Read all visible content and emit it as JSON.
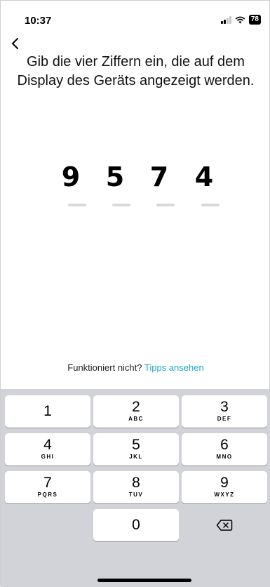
{
  "status": {
    "time": "10:37",
    "battery": "78"
  },
  "instruction": "Gib die vier Ziffern ein, die auf dem Display des Geräts angezeigt werden.",
  "code": [
    "9",
    "5",
    "7",
    "4"
  ],
  "help": {
    "text": "Funktioniert nicht?",
    "link": "Tipps ansehen"
  },
  "keypad": {
    "k1": {
      "num": "1",
      "letters": ""
    },
    "k2": {
      "num": "2",
      "letters": "ABC"
    },
    "k3": {
      "num": "3",
      "letters": "DEF"
    },
    "k4": {
      "num": "4",
      "letters": "GHI"
    },
    "k5": {
      "num": "5",
      "letters": "JKL"
    },
    "k6": {
      "num": "6",
      "letters": "MNO"
    },
    "k7": {
      "num": "7",
      "letters": "PQRS"
    },
    "k8": {
      "num": "8",
      "letters": "TUV"
    },
    "k9": {
      "num": "9",
      "letters": "WXYZ"
    },
    "k0": {
      "num": "0",
      "letters": ""
    }
  },
  "colors": {
    "link": "#1fa8c4",
    "keypad_bg": "#d2d3d8"
  },
  "icons": {
    "back": "chevron-left-icon",
    "delete": "backspace-icon"
  }
}
